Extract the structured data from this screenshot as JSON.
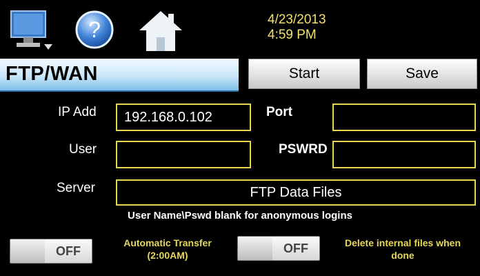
{
  "header": {
    "date": "4/23/2013",
    "time": "4:59 PM",
    "icons": [
      "monitor-icon",
      "help-icon",
      "home-icon"
    ]
  },
  "title": "FTP/WAN",
  "buttons": {
    "start": "Start",
    "save": "Save"
  },
  "form": {
    "ip_label": "IP Add",
    "ip_value": "192.168.0.102",
    "port_label": "Port",
    "port_value": "",
    "user_label": "User",
    "user_value": "",
    "pswrd_label": "PSWRD",
    "pswrd_value": "",
    "server_label": "Server",
    "server_value": "FTP Data Files"
  },
  "note": "User Name\\Pswd blank for anonymous logins",
  "toggles": {
    "auto_transfer": {
      "state": "OFF",
      "label_line1": "Automatic Transfer",
      "label_line2": "(2:00AM)"
    },
    "delete_files": {
      "state": "OFF",
      "label_line1": "Delete internal files when",
      "label_line2": "done"
    }
  },
  "colors": {
    "accent_yellow": "#e6d84a",
    "title_blue": "#7fbfe8",
    "background": "#000000"
  }
}
